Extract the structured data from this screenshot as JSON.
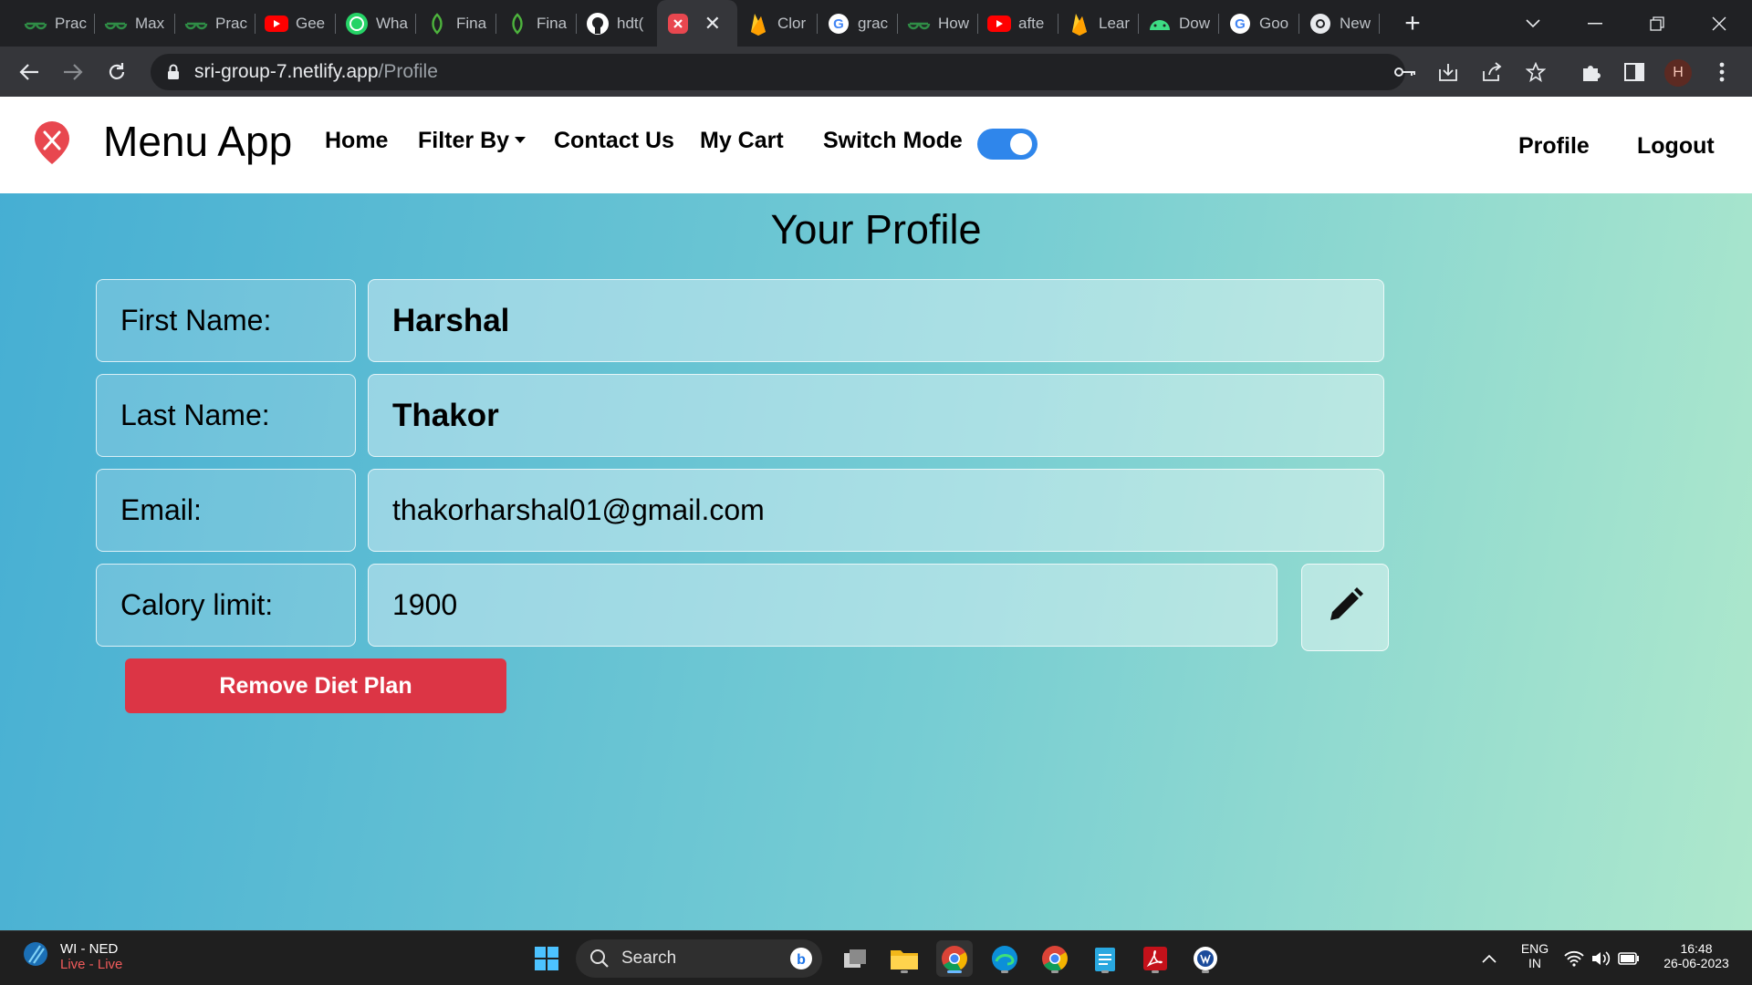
{
  "browser": {
    "tabs": [
      {
        "label": "Prac",
        "icon": "gfg-icon"
      },
      {
        "label": "Max",
        "icon": "gfg-icon"
      },
      {
        "label": "Prac",
        "icon": "gfg-icon"
      },
      {
        "label": "Gee",
        "icon": "youtube-icon"
      },
      {
        "label": "Wha",
        "icon": "whatsapp-icon"
      },
      {
        "label": "Fina",
        "icon": "mongodb-leaf-icon"
      },
      {
        "label": "Fina",
        "icon": "mongodb-leaf-icon"
      },
      {
        "label": "hdt(",
        "icon": "github-icon"
      },
      {
        "label": "",
        "icon": "menu-app-icon",
        "active": true
      },
      {
        "label": "Clor",
        "icon": "firebase-icon"
      },
      {
        "label": "grac",
        "icon": "google-icon"
      },
      {
        "label": "How",
        "icon": "gfg-icon"
      },
      {
        "label": "afte",
        "icon": "youtube-icon"
      },
      {
        "label": "Lear",
        "icon": "firebase-icon"
      },
      {
        "label": "Dow",
        "icon": "android-icon"
      },
      {
        "label": "Goo",
        "icon": "google-icon"
      },
      {
        "label": "New",
        "icon": "chrome-icon"
      }
    ],
    "url_host": "sri-group-7.netlify.app",
    "url_path": "/Profile",
    "profile_initial": "H"
  },
  "navbar": {
    "brand": "Menu App",
    "home": "Home",
    "filter": "Filter By",
    "contact": "Contact Us",
    "cart": "My Cart",
    "switch_mode": "Switch Mode",
    "dark_mode_on": true,
    "profile": "Profile",
    "logout": "Logout"
  },
  "profile": {
    "title": "Your Profile",
    "first_name_label": "First Name:",
    "first_name": "Harshal",
    "last_name_label": "Last Name:",
    "last_name": "Thakor",
    "email_label": "Email:",
    "email": "thakorharshal01@gmail.com",
    "calory_label": "Calory limit:",
    "calory": "1900",
    "remove_button": "Remove Diet Plan"
  },
  "taskbar": {
    "weather_title": "WI - NED",
    "weather_sub": "Live - Live",
    "search": "Search",
    "lang": "ENG",
    "region": "IN",
    "time": "16:48",
    "date": "26-06-2023"
  },
  "colors": {
    "accent_toggle": "#2f86eb",
    "danger": "#dc3545",
    "brand_logo": "#e8474f"
  }
}
